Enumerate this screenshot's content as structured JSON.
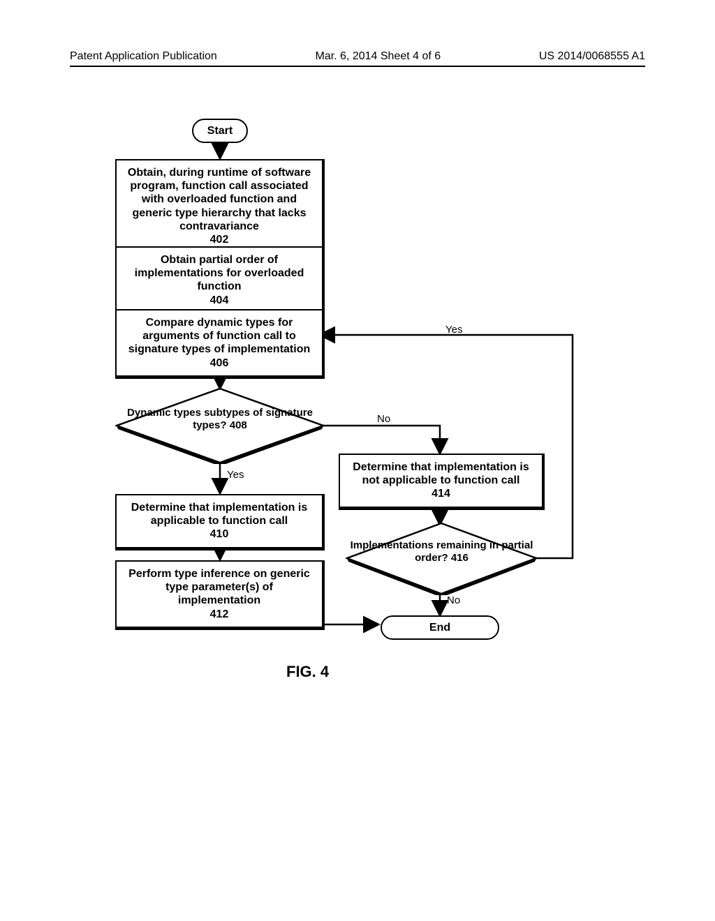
{
  "header": {
    "left": "Patent Application Publication",
    "center": "Mar. 6, 2014  Sheet 4 of 6",
    "right": "US 2014/0068555 A1"
  },
  "nodes": {
    "start": "Start",
    "n402": "Obtain, during runtime of software program, function call associated with overloaded function and generic type hierarchy that lacks contravariance\n402",
    "n404": "Obtain partial order of implementations for overloaded function\n404",
    "n406": "Compare dynamic types for arguments of function call to signature types of implementation\n406",
    "n408": "Dynamic types subtypes of signature types?\n408",
    "n410": "Determine that implementation is applicable to function call\n410",
    "n412": "Perform type inference on generic type parameter(s) of implementation\n412",
    "n414": "Determine that implementation is not applicable to function call\n414",
    "n416": "Implementations remaining in partial order?\n416",
    "end": "End"
  },
  "labels": {
    "yes1": "Yes",
    "no1": "No",
    "yes2": "Yes",
    "no2": "No"
  },
  "figure": "FIG. 4"
}
